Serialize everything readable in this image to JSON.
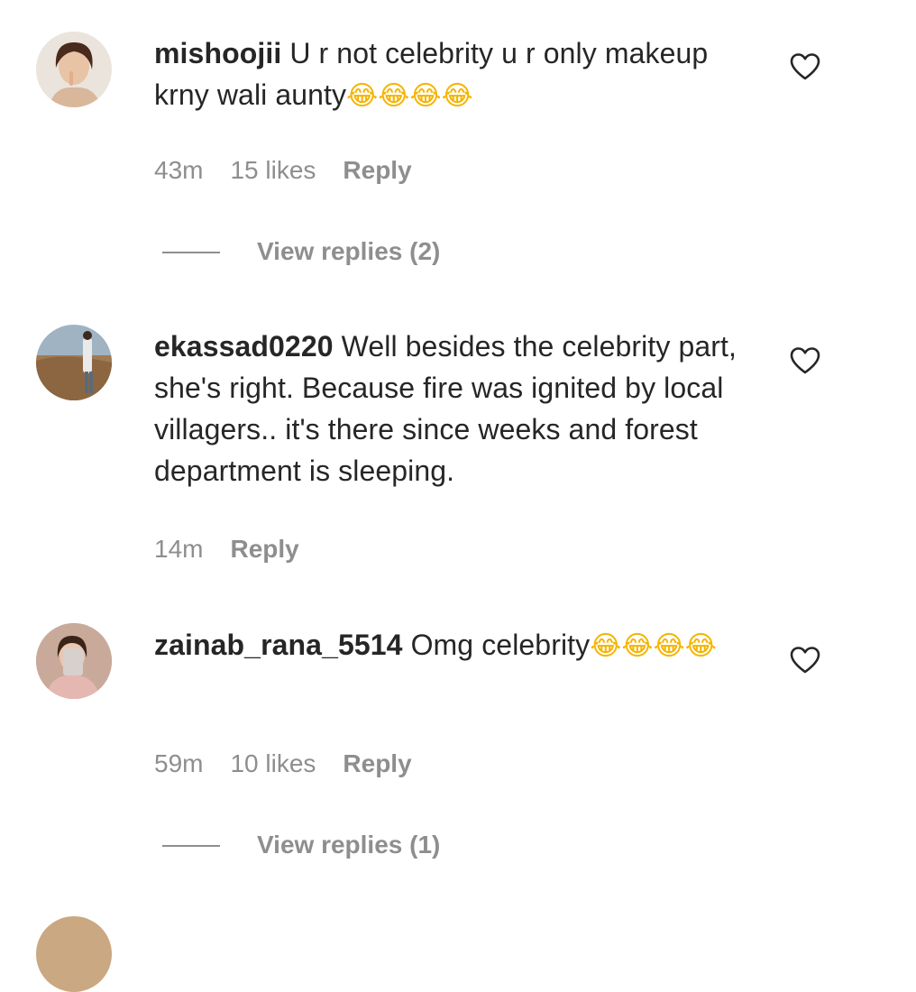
{
  "comments": [
    {
      "username": "mishoojii",
      "text": "U r not celebrity u r only makeup krny wali aunty",
      "emoji": "😂😂😂😂",
      "time": "43m",
      "likes": "15 likes",
      "reply_label": "Reply",
      "view_replies": "View replies (2)"
    },
    {
      "username": "ekassad0220",
      "text": "Well besides the celebrity part, she's right. Because fire was ignited by local villagers.. it's there since weeks and forest department is sleeping.",
      "time": "14m",
      "reply_label": "Reply"
    },
    {
      "username": "zainab_rana_5514",
      "text": "Omg celebrity",
      "emoji": "😂😂😂😂",
      "time": "59m",
      "likes": "10 likes",
      "reply_label": "Reply",
      "view_replies": "View replies (1)"
    }
  ],
  "icons": {
    "like": "heart-outline-icon"
  },
  "colors": {
    "text": "#262626",
    "secondary": "#8e8e8e",
    "emoji": "#f5b400"
  }
}
